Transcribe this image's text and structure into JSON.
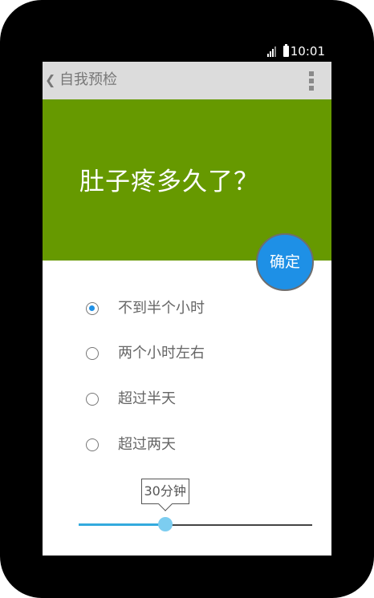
{
  "status_bar": {
    "time": "10:01"
  },
  "app_bar": {
    "back_icon": "chevron-left-icon",
    "title": "自我预检",
    "menu_icon": "more-vert-icon"
  },
  "question": {
    "text": "肚子疼多久了？",
    "background": "#669900"
  },
  "confirm_button": {
    "label": "确定",
    "color": "#1e90e6"
  },
  "options": [
    {
      "label": "不到半个小时",
      "checked": true
    },
    {
      "label": "两个小时左右",
      "checked": false
    },
    {
      "label": "超过半天",
      "checked": false
    },
    {
      "label": "超过两天",
      "checked": false
    }
  ],
  "slider": {
    "tooltip": "30分钟",
    "value_fraction": 0.37,
    "accent": "#33aadd"
  }
}
